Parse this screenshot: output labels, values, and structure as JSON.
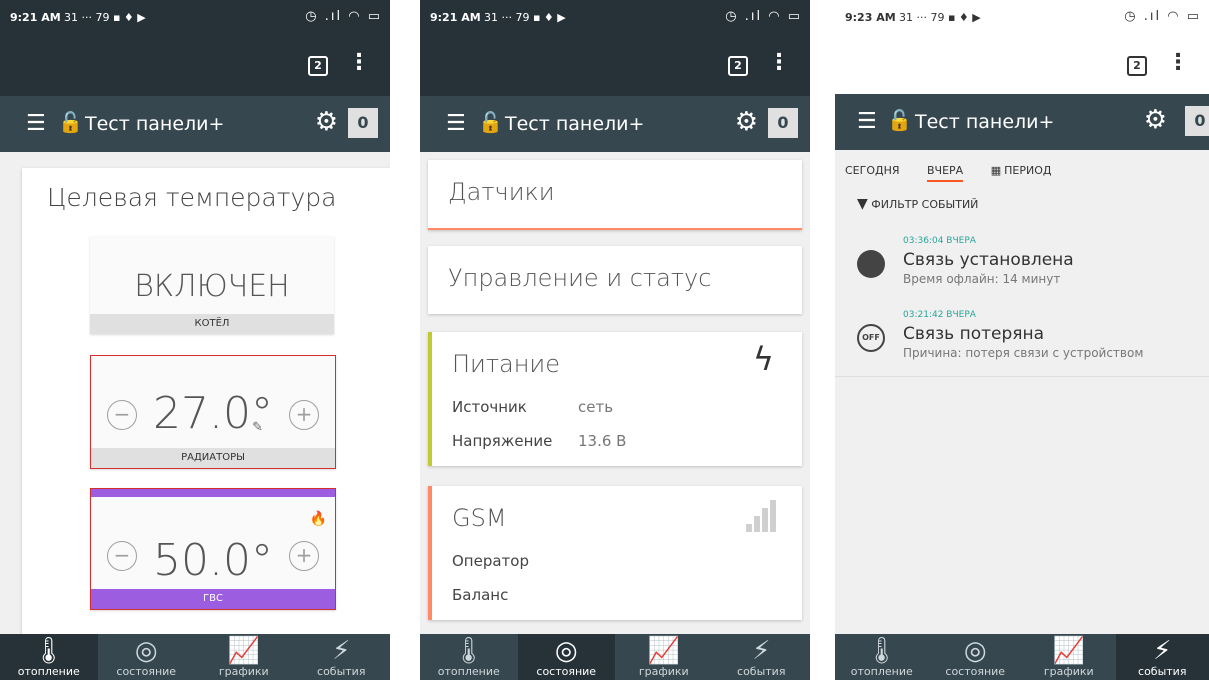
{
  "status": {
    "time_left": "9:21 AM",
    "time_right": "9:23 AM",
    "notif_icons": "31 ··· 79 ▪ ♦ ▶",
    "system_icons": "◷ .ıl ◠ ▭"
  },
  "browser": {
    "tabs_count": "2",
    "menu": "⋮"
  },
  "app": {
    "title": "Тест панели+",
    "count": "0"
  },
  "nav": {
    "items": [
      {
        "label": "отопление",
        "icon": "thermometer-icon"
      },
      {
        "label": "состояние",
        "icon": "circle-icon"
      },
      {
        "label": "графики",
        "icon": "chart-icon"
      },
      {
        "label": "события",
        "icon": "bolt-icon"
      }
    ]
  },
  "heating": {
    "title": "Целевая температура",
    "boiler": {
      "value": "ВКЛЮЧЕН",
      "label": "КОТЁЛ"
    },
    "radiators": {
      "value": "27.0°",
      "label": "РАДИАТОРЫ"
    },
    "dhw": {
      "value": "50.0°",
      "label": "ГВС"
    }
  },
  "status_page": {
    "sensors": "Датчики",
    "control": "Управление и статус",
    "power": {
      "title": "Питание",
      "source_label": "Источник",
      "source_value": "сеть",
      "voltage_label": "Напряжение",
      "voltage_value": "13.6 В"
    },
    "gsm": {
      "title": "GSM",
      "operator_label": "Оператор",
      "balance_label": "Баланс"
    }
  },
  "events_page": {
    "tabs": [
      "СЕГОДНЯ",
      "ВЧЕРА",
      "ПЕРИОД"
    ],
    "period_icon": "calendar-icon",
    "filter": "ФИЛЬТР СОБЫТИЙ",
    "events": [
      {
        "time": "03:36:04 ВЧЕРА",
        "title": "Связь установлена",
        "sub": "Время офлайн: 14 минут",
        "icon": "filled-circle-icon"
      },
      {
        "time": "03:21:42 ВЧЕРА",
        "title": "Связь потеряна",
        "sub": "Причина: потеря связи с устройством",
        "icon": "off-icon",
        "icon_text": "OFF"
      }
    ]
  }
}
